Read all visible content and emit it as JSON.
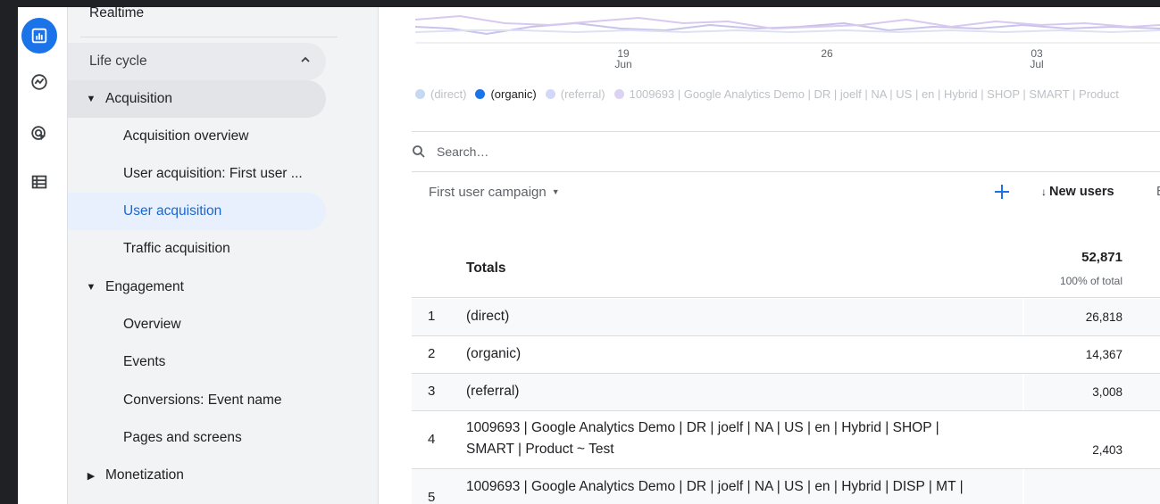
{
  "nav": {
    "realtime": "Realtime",
    "section": "Life cycle",
    "acquisition": "Acquisition",
    "acquisition_items": [
      "Acquisition overview",
      "User acquisition: First user ...",
      "User acquisition",
      "Traffic acquisition"
    ],
    "engagement": "Engagement",
    "engagement_items": [
      "Overview",
      "Events",
      "Conversions: Event name",
      "Pages and screens"
    ],
    "monetization": "Monetization"
  },
  "chart": {
    "ticks": [
      {
        "day": "19",
        "month": "Jun"
      },
      {
        "day": "26",
        "month": ""
      },
      {
        "day": "03",
        "month": "Jul"
      }
    ]
  },
  "legend": [
    {
      "label": "(direct)",
      "color": "#c5d9f1",
      "muted": true
    },
    {
      "label": "(organic)",
      "color": "#1a73e8",
      "muted": false
    },
    {
      "label": "(referral)",
      "color": "#d2d8f7",
      "muted": true
    },
    {
      "label": "1009693 | Google Analytics Demo | DR | joelf | NA | US | en | Hybrid | SHOP | SMART | Product",
      "color": "#dcd3f2",
      "muted": true
    }
  ],
  "search": {
    "placeholder": "Search…"
  },
  "table": {
    "dimension": "First user campaign",
    "metric": "New users",
    "next_col": "E",
    "totals_label": "Totals",
    "totals_value": "52,871",
    "totals_pct": "100% of total",
    "rows": [
      {
        "idx": "1",
        "name": "(direct)",
        "value": "26,818"
      },
      {
        "idx": "2",
        "name": "(organic)",
        "value": "14,367"
      },
      {
        "idx": "3",
        "name": "(referral)",
        "value": "3,008"
      },
      {
        "idx": "4",
        "name": "1009693 | Google Analytics Demo | DR | joelf | NA | US | en | Hybrid | SHOP | SMART | Product ~ Test",
        "value": "2,403"
      },
      {
        "idx": "5",
        "name": "1009693 | Google Analytics Demo | DR | joelf | NA | US | en | Hybrid | DISP | MT |",
        "value": ""
      }
    ]
  },
  "colors": {
    "accent": "#1a73e8",
    "nav_bg": "#f1f3f4",
    "selected_bg": "#e8f0fe",
    "active_bg": "#e2e4e7"
  }
}
